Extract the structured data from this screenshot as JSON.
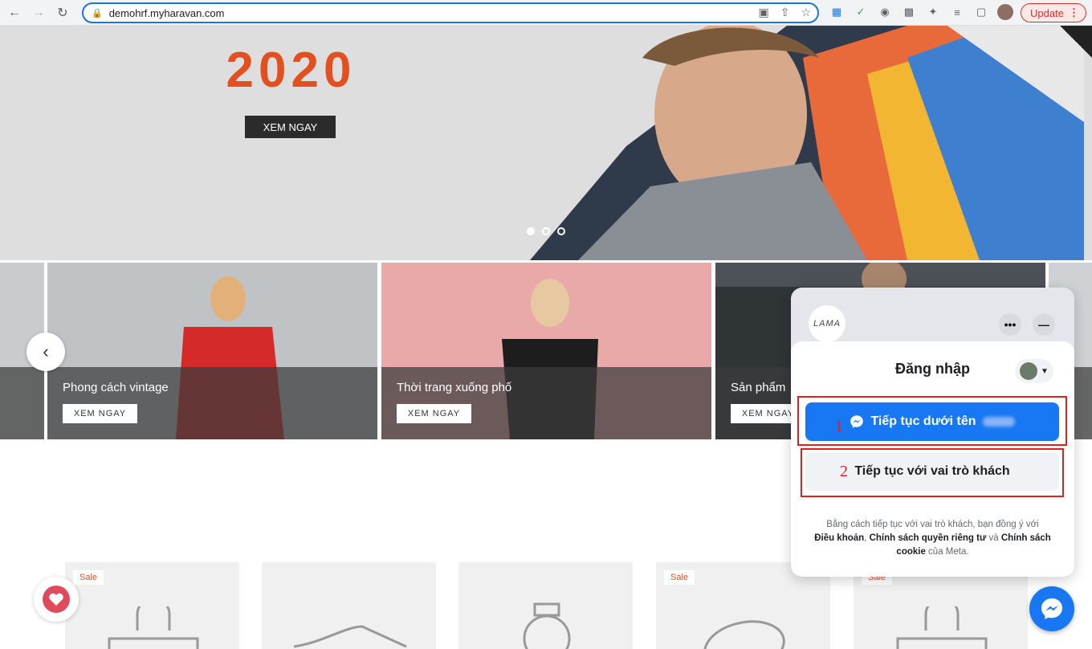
{
  "browser": {
    "url": "demohrf.myharavan.com",
    "update_label": "Update"
  },
  "hero": {
    "year": "2020",
    "cta": "XEM NGAY"
  },
  "collections": [
    {
      "title": "Phong cách vintage",
      "cta": "XEM NGAY"
    },
    {
      "title": "Thời trang xuống phố",
      "cta": "XEM NGAY"
    },
    {
      "title": "Sản phẩm",
      "cta": "XEM NGAY"
    }
  ],
  "products": [
    {
      "badge": "Sale"
    },
    {
      "badge": ""
    },
    {
      "badge": ""
    },
    {
      "badge": "Sale"
    },
    {
      "badge": "Sale"
    }
  ],
  "chat": {
    "page_avatar_text": "LAMA",
    "more_label": "•••",
    "minimize_label": "—",
    "login_title": "Đăng nhập",
    "continue_as_label": "Tiếp tục dưới tên",
    "continue_guest_label": "Tiếp tục với vai trò khách",
    "marker_1": "1",
    "marker_2": "2",
    "terms_prefix": "Bằng cách tiếp tục với vai trò khách, bạn đồng ý với",
    "terms_link_1": "Điều khoản",
    "terms_sep": ", ",
    "terms_link_2": "Chính sách quyền riêng tư",
    "terms_and": " và ",
    "terms_link_3": "Chính sách cookie",
    "terms_suffix": " của Meta."
  },
  "colors": {
    "accent": "#e2501f",
    "messenger_blue": "#1877f2",
    "annotation_red": "#e02020"
  }
}
